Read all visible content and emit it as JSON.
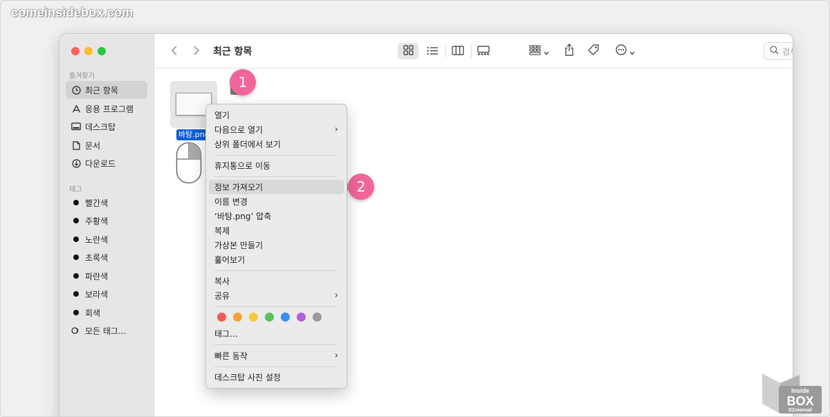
{
  "site": {
    "label": "comeinsidebox.com"
  },
  "window": {
    "traffic_lights": {
      "close": "#fe5f57",
      "minimize": "#febc2e",
      "zoom": "#28c840"
    }
  },
  "sidebar": {
    "favorites_heading": "즐겨찾기",
    "favorites": [
      {
        "label": "최근 항목",
        "icon": "clock-icon",
        "active": true
      },
      {
        "label": "응용 프로그램",
        "icon": "applications-icon"
      },
      {
        "label": "데스크탑",
        "icon": "desktop-icon"
      },
      {
        "label": "문서",
        "icon": "document-icon"
      },
      {
        "label": "다운로드",
        "icon": "download-icon"
      }
    ],
    "tags_heading": "태그",
    "tags": [
      {
        "label": "빨간색"
      },
      {
        "label": "주황색"
      },
      {
        "label": "노란색"
      },
      {
        "label": "초록색"
      },
      {
        "label": "파란색"
      },
      {
        "label": "보라색"
      },
      {
        "label": "회색"
      },
      {
        "label": "모든 태그..."
      }
    ]
  },
  "toolbar": {
    "title": "최근 항목",
    "search_placeholder": "검색"
  },
  "file": {
    "name": "바탕.png"
  },
  "steps": {
    "one": "1",
    "two": "2"
  },
  "context_menu": {
    "open": "열기",
    "open_with": "다음으로 열기",
    "show_enclosing": "상위 폴더에서 보기",
    "move_to_trash": "휴지통으로 이동",
    "get_info": "정보 가져오기",
    "rename": "이름 변경",
    "compress": "‘바탕.png’ 압축",
    "duplicate": "복제",
    "make_alias": "가상본 만들기",
    "quick_look": "훑어보기",
    "copy": "복사",
    "share": "공유",
    "tag_colors": [
      "#ed5b57",
      "#f3a33a",
      "#f4ca3e",
      "#5ac05a",
      "#3a8ff6",
      "#b35fd6",
      "#9a9a9a"
    ],
    "tags": "태그...",
    "quick_actions": "빠른 동작",
    "set_desktop_picture": "데스크탑 사진 설정"
  },
  "watermark": {
    "text": "Inside BOX EZmanual"
  }
}
